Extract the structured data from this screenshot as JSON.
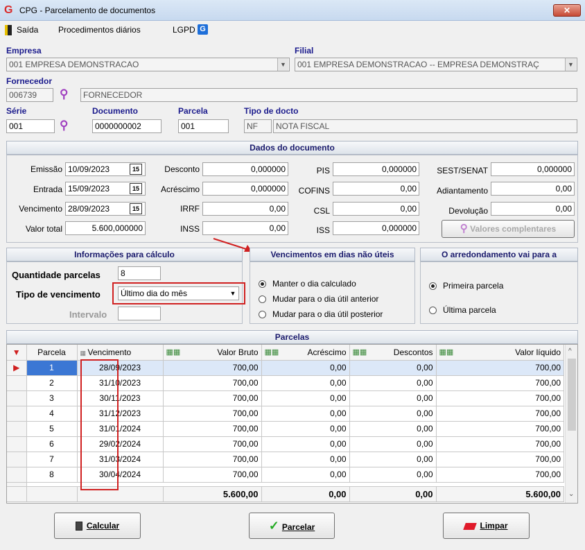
{
  "window": {
    "title": "CPG - Parcelamento de documentos",
    "close": "✕"
  },
  "menu": {
    "items": [
      "Saída",
      "Procedimentos diários",
      "LGPD"
    ]
  },
  "empresa": {
    "label": "Empresa",
    "value": "001 EMPRESA DEMONSTRACAO"
  },
  "filial": {
    "label": "Filial",
    "value": "001 EMPRESA DEMONSTRACAO -- EMPRESA DEMONSTRAÇ"
  },
  "fornecedor": {
    "label": "Fornecedor",
    "code": "006739",
    "name": "FORNECEDOR"
  },
  "serie": {
    "label": "Série",
    "value": "001"
  },
  "documento": {
    "label": "Documento",
    "value": "0000000002"
  },
  "parcela": {
    "label": "Parcela",
    "value": "001"
  },
  "tipo_docto": {
    "label": "Tipo de docto",
    "code": "NF",
    "name": "NOTA FISCAL"
  },
  "dados": {
    "title": "Dados do documento",
    "emissao": {
      "label": "Emissão",
      "value": "10/09/2023"
    },
    "entrada": {
      "label": "Entrada",
      "value": "15/09/2023"
    },
    "vencimento": {
      "label": "Vencimento",
      "value": "28/09/2023"
    },
    "valor_total": {
      "label": "Valor total",
      "value": "5.600,000000"
    },
    "desconto": {
      "label": "Desconto",
      "value": "0,000000"
    },
    "acrescimo": {
      "label": "Acréscimo",
      "value": "0,000000"
    },
    "irrf": {
      "label": "IRRF",
      "value": "0,00"
    },
    "inss": {
      "label": "INSS",
      "value": "0,00"
    },
    "pis": {
      "label": "PIS",
      "value": "0,000000"
    },
    "cofins": {
      "label": "COFINS",
      "value": "0,00"
    },
    "csl": {
      "label": "CSL",
      "value": "0,00"
    },
    "iss": {
      "label": "ISS",
      "value": "0,000000"
    },
    "sest": {
      "label": "SEST/SENAT",
      "value": "0,000000"
    },
    "adiantamento": {
      "label": "Adiantamento",
      "value": "0,00"
    },
    "devolucao": {
      "label": "Devolução",
      "value": "0,00"
    },
    "valores_btn": "Valores complentares",
    "cal_icon": "15"
  },
  "calculo": {
    "title": "Informações para cálculo",
    "qtd_label": "Quantidade parcelas",
    "qtd_value": "8",
    "tipo_label": "Tipo de vencimento",
    "tipo_value": "Último dia do mês",
    "intervalo_label": "Intervalo",
    "intervalo_value": ""
  },
  "nao_uteis": {
    "title": "Vencimentos em dias não úteis",
    "options": [
      "Manter o dia calculado",
      "Mudar para o dia útil anterior",
      "Mudar para o dia útil posterior"
    ]
  },
  "arredondamento": {
    "title": "O arredondamento vai para a",
    "options": [
      "Primeira parcela",
      "Última parcela"
    ]
  },
  "parcelas": {
    "title": "Parcelas",
    "headers": [
      "Parcela",
      "Vencimento",
      "Valor Bruto",
      "Acréscimo",
      "Descontos",
      "Valor líquido"
    ],
    "rows": [
      [
        "1",
        "28/09/2023",
        "700,00",
        "0,00",
        "0,00",
        "700,00"
      ],
      [
        "2",
        "31/10/2023",
        "700,00",
        "0,00",
        "0,00",
        "700,00"
      ],
      [
        "3",
        "30/11/2023",
        "700,00",
        "0,00",
        "0,00",
        "700,00"
      ],
      [
        "4",
        "31/12/2023",
        "700,00",
        "0,00",
        "0,00",
        "700,00"
      ],
      [
        "5",
        "31/01/2024",
        "700,00",
        "0,00",
        "0,00",
        "700,00"
      ],
      [
        "6",
        "29/02/2024",
        "700,00",
        "0,00",
        "0,00",
        "700,00"
      ],
      [
        "7",
        "31/03/2024",
        "700,00",
        "0,00",
        "0,00",
        "700,00"
      ],
      [
        "8",
        "30/04/2024",
        "700,00",
        "0,00",
        "0,00",
        "700,00"
      ]
    ],
    "totals": [
      "5.600,00",
      "0,00",
      "0,00",
      "5.600,00"
    ]
  },
  "buttons": {
    "calcular": "Calcular",
    "parcelar": "Parcelar",
    "limpar": "Limpar"
  }
}
